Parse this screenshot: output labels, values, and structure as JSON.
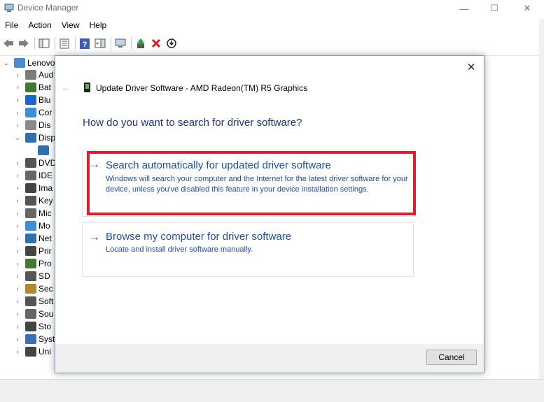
{
  "window": {
    "title": "Device Manager",
    "min_glyph": "—",
    "max_glyph": "☐",
    "close_glyph": "✕"
  },
  "menu": [
    "File",
    "Action",
    "View",
    "Help"
  ],
  "tree": {
    "root": "Lenovo",
    "items": [
      {
        "label": "Aud",
        "icon": "audio-icon",
        "state": "collapsed"
      },
      {
        "label": "Bat",
        "icon": "battery-icon",
        "state": "collapsed"
      },
      {
        "label": "Blu",
        "icon": "bluetooth-icon",
        "state": "collapsed"
      },
      {
        "label": "Cor",
        "icon": "computer-icon",
        "state": "collapsed"
      },
      {
        "label": "Dis",
        "icon": "disk-icon",
        "state": "collapsed"
      },
      {
        "label": "Disp",
        "icon": "display-adapter-icon",
        "state": "expanded"
      },
      {
        "label": "",
        "icon": "display-adapter-icon",
        "state": "child"
      },
      {
        "label": "DVD",
        "icon": "dvd-icon",
        "state": "collapsed"
      },
      {
        "label": "IDE",
        "icon": "ide-icon",
        "state": "collapsed"
      },
      {
        "label": "Ima",
        "icon": "imaging-icon",
        "state": "collapsed"
      },
      {
        "label": "Key",
        "icon": "keyboard-icon",
        "state": "collapsed"
      },
      {
        "label": "Mic",
        "icon": "mouse-icon",
        "state": "collapsed"
      },
      {
        "label": "Mo",
        "icon": "monitor-icon",
        "state": "collapsed"
      },
      {
        "label": "Net",
        "icon": "network-icon",
        "state": "collapsed"
      },
      {
        "label": "Prir",
        "icon": "printer-icon",
        "state": "collapsed"
      },
      {
        "label": "Pro",
        "icon": "processor-icon",
        "state": "collapsed"
      },
      {
        "label": "SD",
        "icon": "sd-host-icon",
        "state": "collapsed"
      },
      {
        "label": "Sec",
        "icon": "security-icon",
        "state": "collapsed"
      },
      {
        "label": "Soft",
        "icon": "software-icon",
        "state": "collapsed"
      },
      {
        "label": "Sou",
        "icon": "sound-icon",
        "state": "collapsed"
      },
      {
        "label": "Sto",
        "icon": "storage-icon",
        "state": "collapsed"
      },
      {
        "label": "Syst",
        "icon": "system-icon",
        "state": "collapsed"
      },
      {
        "label": "Uni",
        "icon": "usb-icon",
        "state": "collapsed"
      }
    ]
  },
  "dialog": {
    "title": "Update Driver Software - AMD Radeon(TM) R5 Graphics",
    "heading": "How do you want to search for driver software?",
    "options": [
      {
        "arrow": "→",
        "title": "Search automatically for updated driver software",
        "description": "Windows will search your computer and the Internet for the latest driver software for your device, unless you've disabled this feature in your device installation settings."
      },
      {
        "arrow": "→",
        "title": "Browse my computer for driver software",
        "description": "Locate and install driver software manually."
      }
    ],
    "cancel_label": "Cancel",
    "close_glyph": "✕",
    "back_glyph": "←"
  },
  "colors": {
    "highlight": "#e01e2c",
    "link": "#1e4fa8",
    "heading": "#1e3287"
  }
}
